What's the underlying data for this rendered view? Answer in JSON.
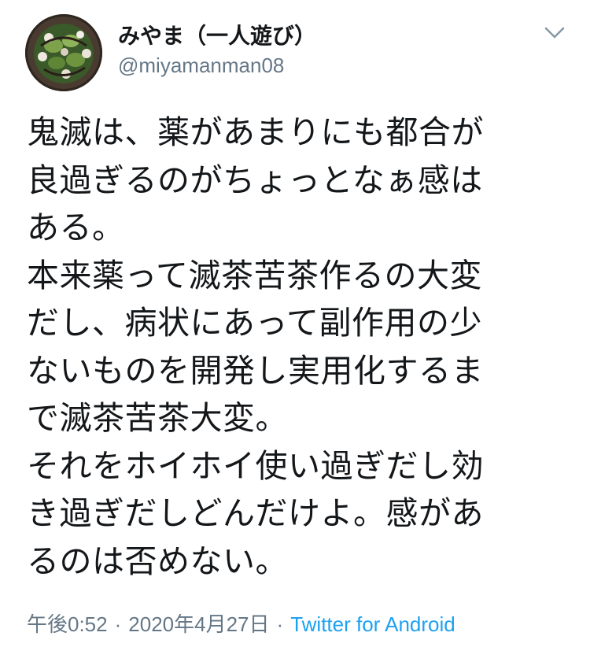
{
  "author": {
    "display_name": "みやま（一人遊び）",
    "handle": "@miyamanman08",
    "avatar_icon": "avatar-food-photo"
  },
  "tweet": {
    "text": "鬼滅は、薬があまりにも都合が\n良過ぎるのがちょっとなぁ感は\nある。\n本来薬って滅茶苦茶作るの大変\nだし、病状にあって副作用の少\nないものを開発し実用化するま\nで滅茶苦茶大変。\nそれをホイホイ使い過ぎだし効\nき過ぎだしどんだけよ。感があ\nるのは否めない。"
  },
  "meta": {
    "time": "午後0:52",
    "separator": "·",
    "date": "2020年4月27日",
    "source": "Twitter for Android"
  },
  "menu": {
    "icon": "chevron-down-icon"
  },
  "colors": {
    "text": "#14171a",
    "secondary": "#657786",
    "link": "#1da1f2",
    "background": "#ffffff"
  }
}
